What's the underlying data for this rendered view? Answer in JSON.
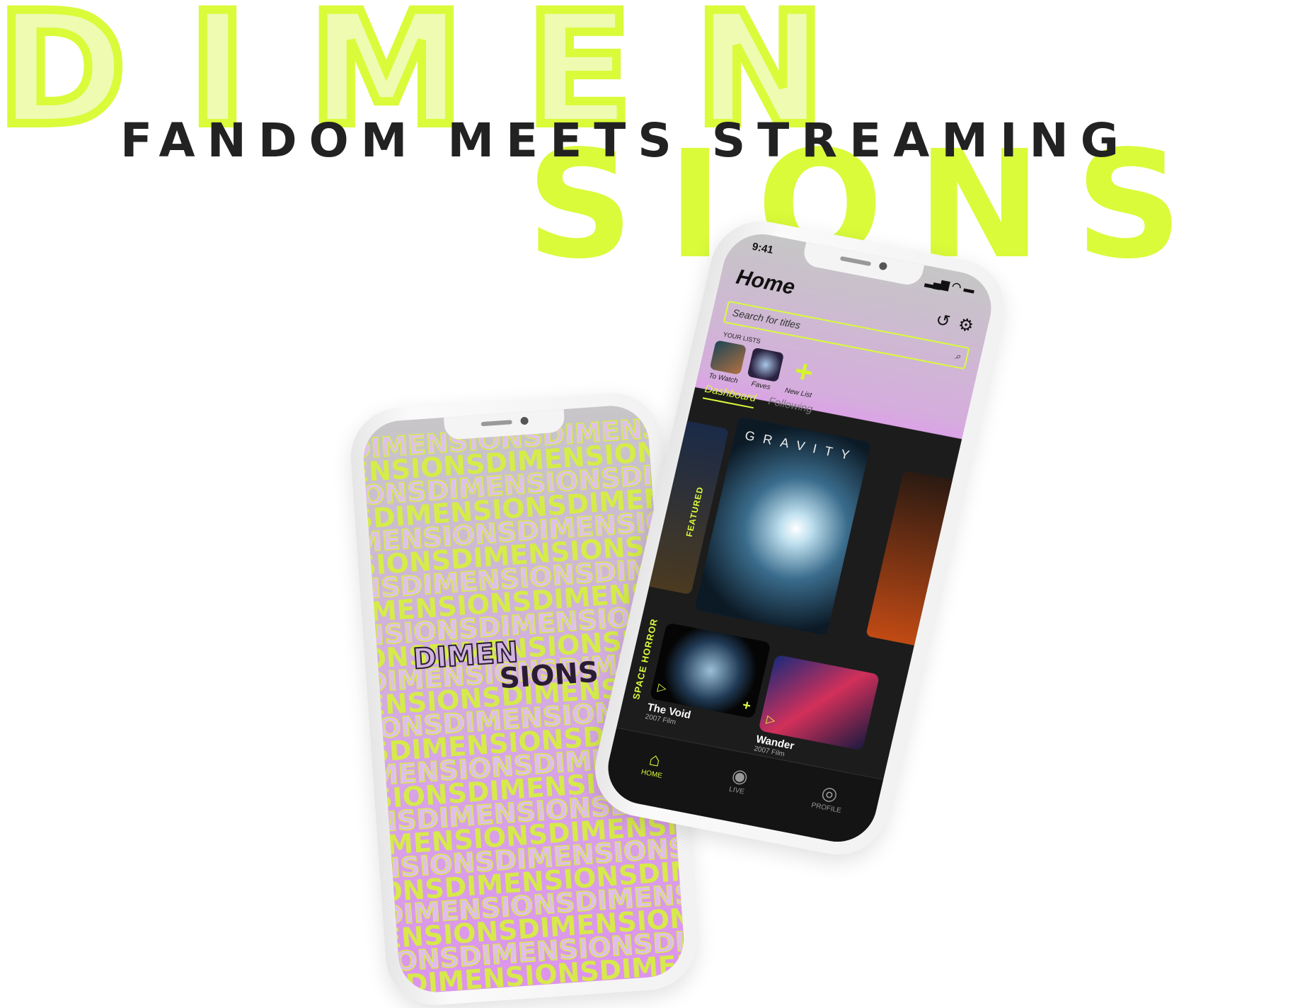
{
  "branding": {
    "logo_top": "DIMEN",
    "logo_bottom": "SIONS",
    "tagline": "FANDOM MEETS STREAMING",
    "accent": "#d9fb3a"
  },
  "splash_phone": {
    "pattern_word": "DIMENSIONS",
    "logo_line1": "DIMEN",
    "logo_line2": "SIONS"
  },
  "app": {
    "status_time": "9:41",
    "title": "Home",
    "header_icons": [
      "history-icon",
      "gear-icon"
    ],
    "search": {
      "placeholder": "Search for titles"
    },
    "lists_heading": "YOUR LISTS",
    "lists": [
      {
        "label": "To Watch"
      },
      {
        "label": "Faves"
      },
      {
        "label": "New List"
      }
    ],
    "tabs": [
      {
        "label": "Dashboard",
        "active": true
      },
      {
        "label": "Following",
        "active": false
      }
    ],
    "featured_label": "FEATURED",
    "featured_poster_title": "GRAVITY",
    "row_label": "SPACE HORROR",
    "row_items": [
      {
        "title": "The Void",
        "subtitle": "2007 Film"
      },
      {
        "title": "Wander",
        "subtitle": "2007 Film"
      }
    ],
    "nav": [
      {
        "label": "HOME",
        "active": true
      },
      {
        "label": "LIVE"
      },
      {
        "label": "PROFILE"
      }
    ]
  }
}
